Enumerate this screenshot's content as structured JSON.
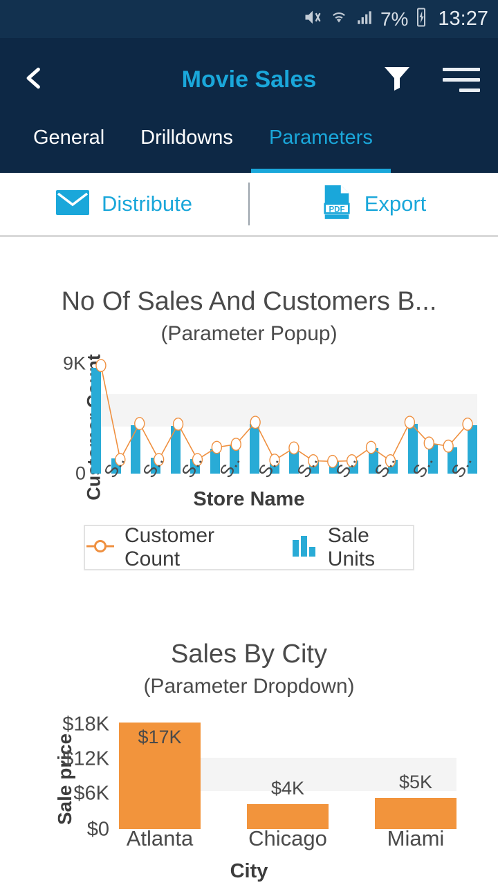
{
  "status_bar": {
    "battery_percent": "7%",
    "time": "13:27",
    "icons": [
      "mute-icon",
      "wifi-icon",
      "cellular-signal-icon",
      "battery-charging-icon"
    ]
  },
  "app_bar": {
    "title": "Movie Sales",
    "back_icon": "chevron-left-icon",
    "filter_icon": "funnel-icon",
    "menu_icon": "hamburger-menu-icon",
    "title_color": "#1aa7da",
    "background_color": "#0d2845"
  },
  "tabs": [
    {
      "label": "General",
      "active": false
    },
    {
      "label": "Drilldowns",
      "active": false
    },
    {
      "label": "Parameters",
      "active": true
    }
  ],
  "action_bar": {
    "distribute_label": "Distribute",
    "distribute_icon": "envelope-icon",
    "export_label": "Export",
    "export_icon": "pdf-file-icon",
    "accent_color": "#1aa7da"
  },
  "chart_data": [
    {
      "type": "bar",
      "title": "No Of Sales And Customers B...",
      "subtitle": "(Parameter Popup)",
      "xlabel": "Store Name",
      "ylabel": "Customer Count",
      "ytick_labels": [
        "9K",
        "0"
      ],
      "ylim": [
        0,
        9000
      ],
      "grid": false,
      "legend_position": "bottom",
      "categories": [
        "S..",
        "S..",
        "S..",
        "S..",
        "S..",
        "S..",
        "S..",
        "S..",
        "S..",
        "S..",
        "S..",
        "S..",
        "S..",
        "S..",
        "S..",
        "S..",
        "S..",
        "S..",
        "S..",
        "S.."
      ],
      "xtick_labels": [
        "S..",
        "S..",
        "S..",
        "S..",
        "S..",
        "S..",
        "S..",
        "S..",
        "S..",
        "S.."
      ],
      "series": [
        {
          "name": "Sale Units",
          "type": "bar",
          "color": "#29abd6",
          "values": [
            8650,
            1250,
            3950,
            1300,
            3900,
            1200,
            2050,
            2350,
            4100,
            1200,
            2050,
            1150,
            1000,
            1100,
            2100,
            1150,
            4100,
            2450,
            2150,
            3950
          ]
        },
        {
          "name": "Customer Count",
          "type": "line",
          "color": "#ef9040",
          "marker": "circle",
          "values": [
            8850,
            1150,
            4100,
            1150,
            4050,
            1150,
            2150,
            2400,
            4200,
            1100,
            2100,
            1050,
            1000,
            1050,
            2150,
            1050,
            4200,
            2500,
            2250,
            4050
          ]
        }
      ]
    },
    {
      "type": "bar",
      "title": "Sales By City",
      "subtitle": "(Parameter Dropdown)",
      "xlabel": "City",
      "ylabel": "Sale price",
      "ytick_labels": [
        "$18K",
        "$12K",
        "$6K",
        "$0"
      ],
      "ylim": [
        0,
        18000
      ],
      "grid": false,
      "bar_color": "#f2943c",
      "categories": [
        "Atlanta",
        "Chicago",
        "Miami"
      ],
      "values": [
        17000,
        4000,
        5000
      ],
      "data_labels": [
        "$17K",
        "$4K",
        "$5K"
      ]
    }
  ]
}
